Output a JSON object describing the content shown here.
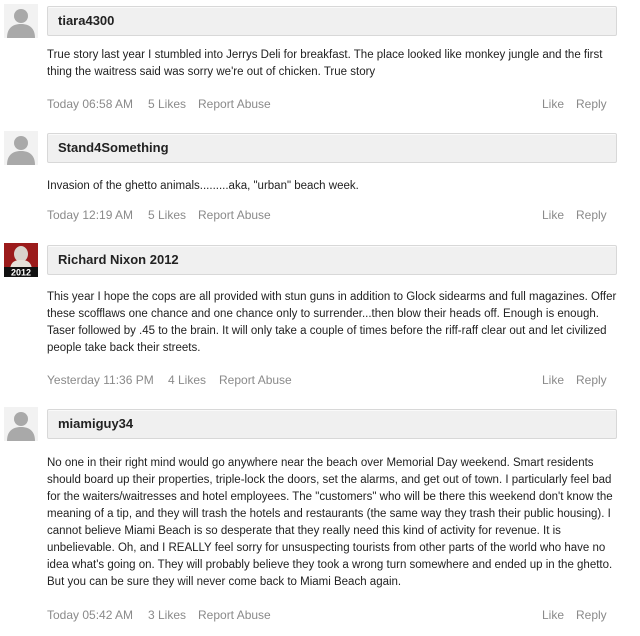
{
  "comments": [
    {
      "username": "tiara4300",
      "avatar": "default-avatar",
      "text": "True story last year I stumbled into Jerrys Deli for breakfast. The place looked like monkey jungle and the first thing the waitress said was sorry we're out of chicken. True story",
      "time": "Today 06:58 AM",
      "likes": "5 Likes",
      "report": "Report Abuse",
      "like": "Like",
      "reply": "Reply"
    },
    {
      "username": "Stand4Something",
      "avatar": "default-avatar",
      "text": "Invasion of the ghetto animals.........aka, \"urban\" beach week.",
      "time": "Today 12:19 AM",
      "likes": "5 Likes",
      "report": "Report Abuse",
      "like": "Like",
      "reply": "Reply"
    },
    {
      "username": "Richard Nixon 2012",
      "avatar": "nixon-2012-avatar",
      "avatar_label": "2012",
      "text": "This year I hope the cops are all provided with stun guns in addition to Glock sidearms and full magazines.  Offer these scofflaws one chance and one chance only to surrender...then blow their heads off.  Enough is enough. Taser followed by .45 to the brain.  It will only take a couple of times before the riff-raff clear out and let civilized people take back their streets.",
      "time": "Yesterday 11:36 PM",
      "likes": "4 Likes",
      "report": "Report Abuse",
      "like": "Like",
      "reply": "Reply"
    },
    {
      "username": "miamiguy34",
      "avatar": "default-avatar",
      "text": "No one in their right mind would go anywhere near the beach over Memorial Day weekend. Smart residents should board up their properties, triple-lock the doors, set the alarms, and get out of town. I particularly feel bad for the waiters/waitresses and hotel employees. The \"customers\" who will be there this weekend don't know the meaning of a tip, and they will trash the hotels and restaurants (the same way they trash their public housing). I cannot believe Miami Beach is so desperate that they really need this kind of activity for revenue. It is unbelievable. Oh, and I REALLY feel sorry for unsuspecting tourists from other parts of the world who have no idea what's going on. They will probably believe they took a wrong turn somewhere and ended up in the ghetto. But you can be sure they will never come back to Miami Beach again.",
      "time": "Today 05:42 AM",
      "likes": "3 Likes",
      "report": "Report Abuse",
      "like": "Like",
      "reply": "Reply"
    }
  ]
}
